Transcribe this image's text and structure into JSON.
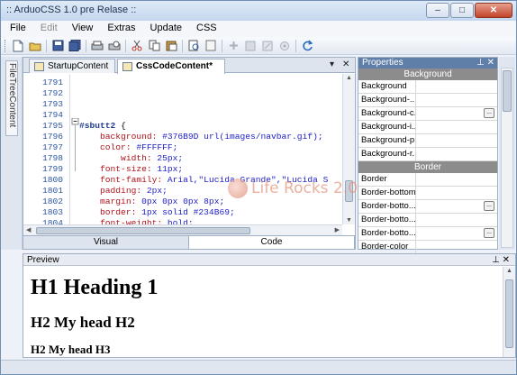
{
  "window": {
    "title": ":: ArduoCSS 1.0 pre Relase ::",
    "min": "–",
    "max": "□",
    "close": "✕"
  },
  "menu": [
    {
      "label": "File",
      "disabled": false
    },
    {
      "label": "Edit",
      "disabled": true
    },
    {
      "label": "View",
      "disabled": false
    },
    {
      "label": "Extras",
      "disabled": false
    },
    {
      "label": "Update",
      "disabled": false
    },
    {
      "label": "CSS",
      "disabled": false
    }
  ],
  "toolbar": {
    "icons": [
      "new-file-icon",
      "open-folder-icon",
      "save-icon",
      "save-all-icon",
      "print-icon",
      "print-preview-icon",
      "cut-icon",
      "copy-icon",
      "paste-icon",
      "find-icon",
      "page-icon",
      "add-icon",
      "block-icon",
      "edit-icon",
      "settings-icon",
      "refresh-icon"
    ]
  },
  "sidebar": {
    "tab_label": "FileTreeContent"
  },
  "editor": {
    "tabs": [
      {
        "label": "StartupContent",
        "active": false
      },
      {
        "label": "CssCodeContent*",
        "active": true
      }
    ],
    "tab_controls": {
      "dropdown": "▾",
      "close": "✕"
    },
    "lines": [
      {
        "num": "1791",
        "segments": []
      },
      {
        "num": "1792",
        "segments": []
      },
      {
        "num": "1793",
        "segments": []
      },
      {
        "num": "1794",
        "segments": []
      },
      {
        "num": "1795",
        "segments": [
          {
            "t": "#sbutt2 ",
            "c": "sel"
          },
          {
            "t": "{",
            "c": "plain"
          }
        ]
      },
      {
        "num": "1796",
        "segments": [
          {
            "t": "    background: ",
            "c": "prop"
          },
          {
            "t": "#376B9D url(images/navbar.gif);",
            "c": "val"
          }
        ]
      },
      {
        "num": "1797",
        "segments": [
          {
            "t": "    color: ",
            "c": "prop"
          },
          {
            "t": "#FFFFFF;",
            "c": "val"
          }
        ]
      },
      {
        "num": "1798",
        "segments": [
          {
            "t": "        width: ",
            "c": "prop"
          },
          {
            "t": "25px;",
            "c": "val"
          }
        ]
      },
      {
        "num": "1799",
        "segments": [
          {
            "t": "    font-size: ",
            "c": "prop"
          },
          {
            "t": "11px;",
            "c": "val"
          }
        ]
      },
      {
        "num": "1800",
        "segments": [
          {
            "t": "    font-family: ",
            "c": "prop"
          },
          {
            "t": "Arial,\"Lucida Grande\",\"Lucida S",
            "c": "val"
          }
        ]
      },
      {
        "num": "1801",
        "segments": [
          {
            "t": "    padding: ",
            "c": "prop"
          },
          {
            "t": "2px;",
            "c": "val"
          }
        ]
      },
      {
        "num": "1802",
        "segments": [
          {
            "t": "    margin: ",
            "c": "prop"
          },
          {
            "t": "0px 0px 0px 8px;",
            "c": "val"
          }
        ]
      },
      {
        "num": "1803",
        "segments": [
          {
            "t": "    border: ",
            "c": "prop"
          },
          {
            "t": "1px solid #234B69;",
            "c": "val"
          }
        ]
      },
      {
        "num": "1804",
        "segments": [
          {
            "t": "    font-weight: ",
            "c": "prop"
          },
          {
            "t": "bold;",
            "c": "val"
          }
        ]
      }
    ],
    "mode_tabs": [
      {
        "label": "Visual",
        "active": false
      },
      {
        "label": "Code",
        "active": true
      }
    ]
  },
  "properties": {
    "title": "Properties",
    "pin": "⊥",
    "close": "✕",
    "groups": [
      {
        "name": "Background",
        "rows": [
          {
            "name": "Background",
            "ellipsis": false
          },
          {
            "name": "Background-...",
            "ellipsis": false
          },
          {
            "name": "Background-c...",
            "ellipsis": true
          },
          {
            "name": "Background-i...",
            "ellipsis": false
          },
          {
            "name": "Background-p...",
            "ellipsis": false
          },
          {
            "name": "Background-r...",
            "ellipsis": false
          }
        ]
      },
      {
        "name": "Border",
        "rows": [
          {
            "name": "Border",
            "ellipsis": false
          },
          {
            "name": "Border-bottom",
            "ellipsis": false
          },
          {
            "name": "Border-botto...",
            "ellipsis": true
          },
          {
            "name": "Border-botto...",
            "ellipsis": false
          },
          {
            "name": "Border-botto...",
            "ellipsis": true
          },
          {
            "name": "Border-color",
            "ellipsis": false
          }
        ]
      }
    ]
  },
  "preview": {
    "title": "Preview",
    "pin": "⊥",
    "close": "✕",
    "h1": "H1 Heading 1",
    "h2": "H2 My head H2",
    "h3": "H2 My head H3"
  },
  "watermark": {
    "text": "Life Rocks 2.0"
  },
  "colors": {
    "selector": "#203d8e",
    "property": "#b0121a",
    "value": "#1c1cc9",
    "line_number": "#2b55a0"
  }
}
